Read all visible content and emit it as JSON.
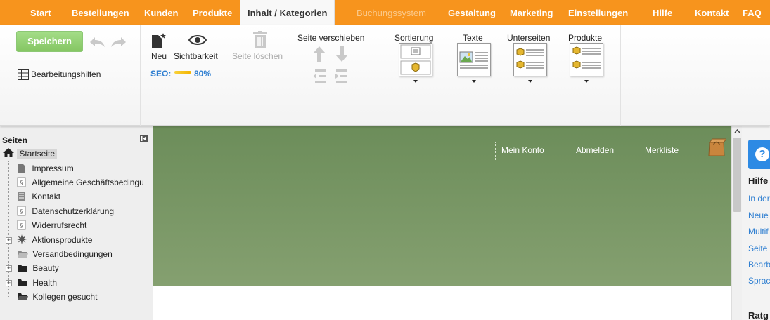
{
  "topnav": {
    "tabs": [
      {
        "label": "Start"
      },
      {
        "label": "Bestellungen"
      },
      {
        "label": "Kunden"
      },
      {
        "label": "Produkte"
      },
      {
        "label": "Inhalt / Kategorien",
        "active": true
      },
      {
        "label": "Buchungssystem",
        "disabled": true
      },
      {
        "label": "Gestaltung"
      },
      {
        "label": "Marketing"
      },
      {
        "label": "Einstellungen"
      },
      {
        "label": "Hilfe"
      },
      {
        "label": "Kontakt"
      },
      {
        "label": "FAQ"
      }
    ]
  },
  "ribbon": {
    "save_label": "Speichern",
    "editing_aids_label": "Bearbeitungshilfen",
    "new_label": "Neu",
    "visibility_label": "Sichtbarkeit",
    "delete_label": "Seite löschen",
    "move_page_label": "Seite verschieben",
    "seo_label": "SEO:",
    "seo_value": "80%",
    "sorting_label": "Sortierung",
    "texts_label": "Texte",
    "subpages_label": "Unterseiten",
    "products_label": "Produkte"
  },
  "pages_panel": {
    "title": "Seiten",
    "items": [
      {
        "label": "Startseite"
      },
      {
        "label": "Impressum"
      },
      {
        "label": "Allgemeine Geschäftsbedingu"
      },
      {
        "label": "Kontakt"
      },
      {
        "label": "Datenschutzerklärung"
      },
      {
        "label": "Widerrufsrecht"
      },
      {
        "label": "Aktionsprodukte"
      },
      {
        "label": "Versandbedingungen"
      },
      {
        "label": "Beauty"
      },
      {
        "label": "Health"
      },
      {
        "label": "Kollegen gesucht"
      }
    ]
  },
  "shop_header": {
    "my_account": "Mein Konto",
    "logout": "Abmelden",
    "wishlist": "Merkliste"
  },
  "help_panel": {
    "title": "Hilfe",
    "links": [
      "In der",
      "Neue",
      "Multif",
      "Seite",
      "Bearb",
      "Sprac"
    ],
    "title2": "Ratg"
  },
  "colors": {
    "accent": "#f7941d",
    "save_green": "#8fd06f",
    "banner_green": "#7a9866",
    "link_blue": "#2f7fd1"
  }
}
